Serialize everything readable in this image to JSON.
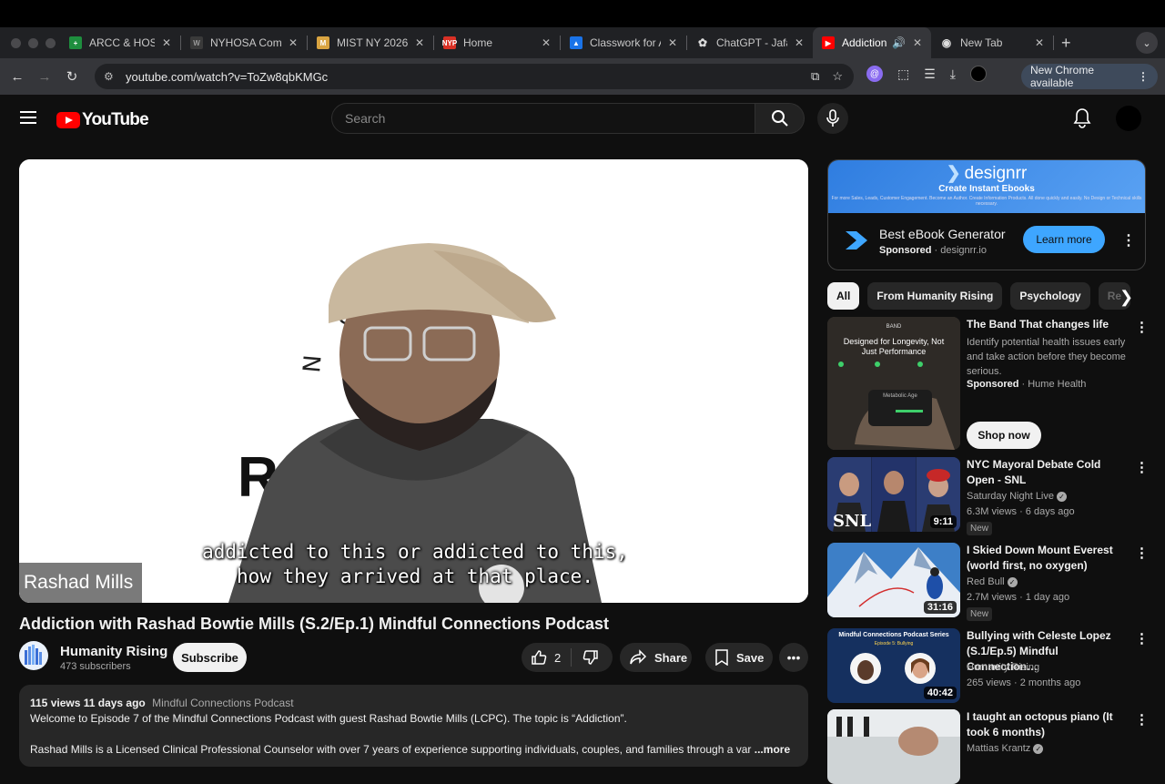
{
  "browser": {
    "tabs": [
      {
        "title": "ARCC & HOSA-",
        "color": "#1e8e3e"
      },
      {
        "title": "NYHOSA Comp",
        "color": "#444444"
      },
      {
        "title": "MIST NY 2026",
        "color": "#d9a441"
      },
      {
        "title": "Home",
        "color": "#d93025",
        "fav_text": "NYP"
      },
      {
        "title": "Classwork for A",
        "color": "#1a73e8"
      },
      {
        "title": "ChatGPT - Jafa",
        "color": "#10a37f"
      },
      {
        "title": "Addiction w",
        "color": "#ff0000",
        "active": true
      },
      {
        "title": "New Tab",
        "color": "#5f6368"
      }
    ],
    "url": "youtube.com/watch?v=ToZw8qbKMGc",
    "update_label": "New Chrome available"
  },
  "youtube": {
    "logo_text": "YouTube",
    "search_placeholder": "Search"
  },
  "player": {
    "name_tag": "Rashad Mills",
    "caption_line1": "addicted to this or addicted to this,",
    "caption_line2": "how they arrived at that place.",
    "bg_text_top": "Now Let's",
    "bg_text_mid": "Ra"
  },
  "video": {
    "title": "Addiction with Rashad Bowtie Mills (S.2/Ep.1) Mindful Connections Podcast",
    "channel": "Humanity Rising",
    "subscribers": "473 subscribers",
    "subscribe_label": "Subscribe",
    "likes": "2",
    "share_label": "Share",
    "save_label": "Save",
    "views_date": "115 views  11 days ago",
    "tag_line": "Mindful Connections Podcast",
    "desc_line1": "Welcome to Episode 7 of the Mindful Connections Podcast with guest Rashad Bowtie Mills (LCPC). The topic is “Addiction”.",
    "desc_line2": "Rashad Mills is a Licensed Clinical Professional Counselor with over 7 years of experience supporting individuals, couples, and families through a var",
    "more_label": "...more"
  },
  "ad": {
    "brand": "designrr",
    "tagline": "Create Instant Ebooks",
    "small_print": "For more Sales, Leads, Customer Engagement. Become an Author. Create Information Products. All done quickly and easily. No Design or Technical skills necessary.",
    "title": "Best eBook Generator",
    "sponsored": "Sponsored",
    "domain": "designrr.io",
    "cta": "Learn more"
  },
  "chips": [
    "All",
    "From Humanity Rising",
    "Psychology",
    "Re"
  ],
  "recommendations": [
    {
      "title": "The Band That changes life",
      "desc": "Identify potential health issues early and take action before they become serious.",
      "sponsored": "Sponsored",
      "advertiser": "Hume Health",
      "cta": "Shop now",
      "thumb_text1": "BAND",
      "thumb_text2": "Designed for Longevity, Not Just Performance",
      "thumb_text3": "Metabolic Age"
    },
    {
      "title": "NYC Mayoral Debate Cold Open - SNL",
      "channel": "Saturday Night Live",
      "stats": "6.3M views · 6 days ago",
      "badge": "New",
      "duration": "9:11",
      "thumb_text": "SNL"
    },
    {
      "title": "I Skied Down Mount Everest (world first, no oxygen)",
      "channel": "Red Bull",
      "stats": "2.7M views · 1 day ago",
      "badge": "New",
      "duration": "31:16"
    },
    {
      "title": "Bullying with Celeste Lopez (S.1/Ep.5) Mindful Connection…",
      "channel": "Humanity Rising",
      "stats": "265 views · 2 months ago",
      "duration": "40:42",
      "thumb_text1": "Mindful Connections Podcast Series",
      "thumb_text2": "Episode 5: Bullying"
    },
    {
      "title": "I taught an octopus piano (It took 6 months)",
      "channel": "Mattias Krantz"
    }
  ]
}
